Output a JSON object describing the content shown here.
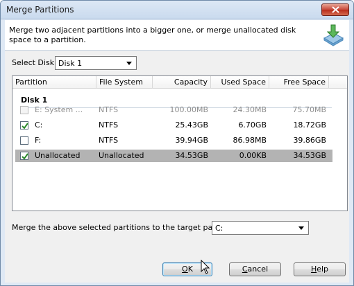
{
  "window": {
    "title": "Merge Partitions"
  },
  "header": {
    "description": "Merge two adjacent partitions into a bigger one, or merge unallocated disk space to a partition.",
    "icon": "merge-disk-icon"
  },
  "disk_select": {
    "label": "Select Disk:",
    "value": "Disk 1"
  },
  "table": {
    "columns": [
      "Partition",
      "File System",
      "Capacity",
      "Used Space",
      "Free Space"
    ],
    "group": "Disk 1",
    "rows": [
      {
        "partition": "E: System ...",
        "fs": "NTFS",
        "capacity": "100.00MB",
        "used": "24.30MB",
        "free": "75.70MB",
        "checked": false,
        "disabled": true,
        "selected": false
      },
      {
        "partition": "C:",
        "fs": "NTFS",
        "capacity": "25.43GB",
        "used": "6.70GB",
        "free": "18.72GB",
        "checked": true,
        "disabled": false,
        "selected": false
      },
      {
        "partition": "F:",
        "fs": "NTFS",
        "capacity": "39.94GB",
        "used": "86.98MB",
        "free": "39.86GB",
        "checked": false,
        "disabled": false,
        "selected": false
      },
      {
        "partition": "Unallocated",
        "fs": "Unallocated",
        "capacity": "34.53GB",
        "used": "0.00KB",
        "free": "34.53GB",
        "checked": true,
        "disabled": false,
        "selected": true
      }
    ]
  },
  "target_select": {
    "label": "Merge the above selected partitions to the target partition:",
    "value": "C:"
  },
  "buttons": {
    "ok": {
      "underline": "O",
      "rest": "K"
    },
    "cancel": {
      "underline": "C",
      "rest": "ancel"
    },
    "help": {
      "underline": "H",
      "rest": "elp"
    }
  },
  "colors": {
    "selected_row": "#b3b3b3",
    "check": "#2a8a2a",
    "close": "#c7483a"
  }
}
